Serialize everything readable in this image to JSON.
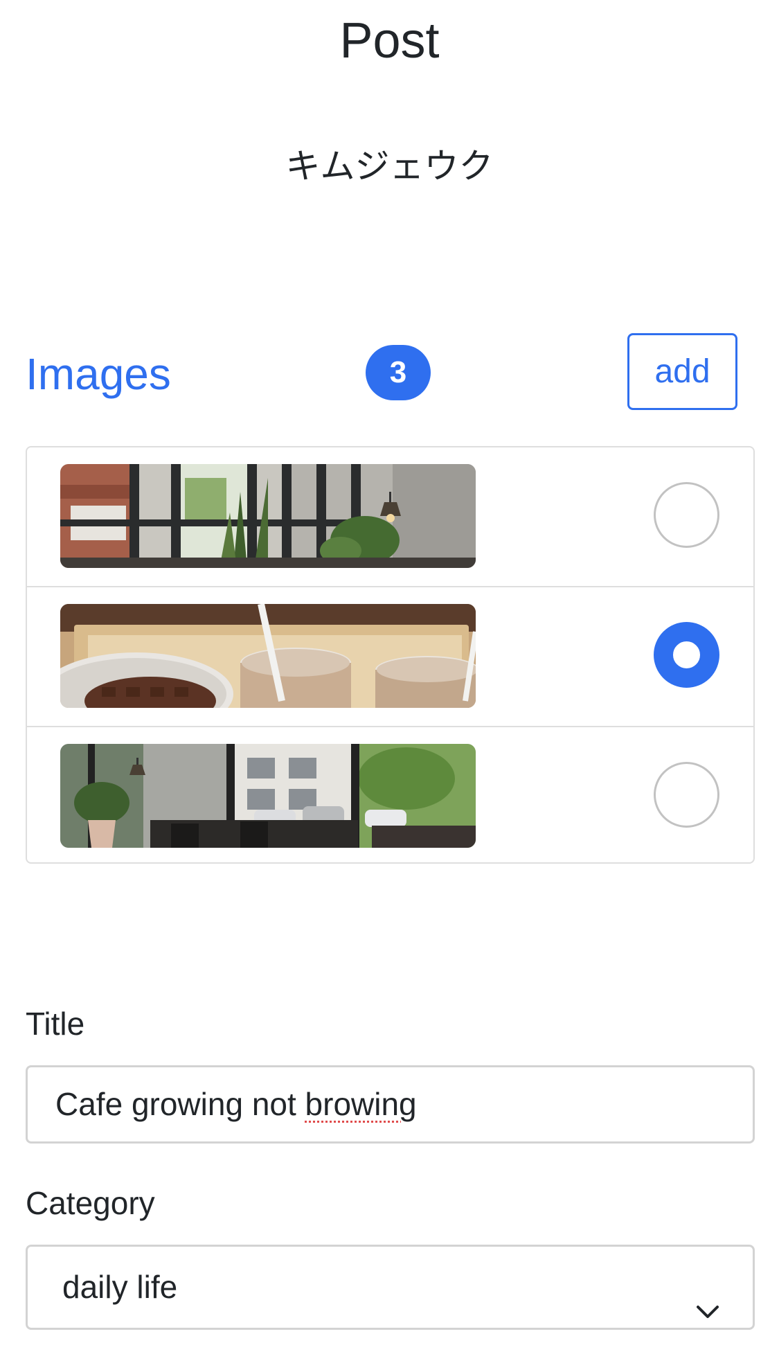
{
  "header": {
    "title": "Post",
    "author": "キムジェウク"
  },
  "images_section": {
    "heading": "Images",
    "count": "3",
    "add_label": "add",
    "items": [
      {
        "name": "cafe-window-interior-photo",
        "selected": false
      },
      {
        "name": "waffle-and-iced-coffee-photo",
        "selected": true
      },
      {
        "name": "cafe-street-view-photo",
        "selected": false
      }
    ]
  },
  "form": {
    "title_label": "Title",
    "title_value_part1": "Cafe growing not ",
    "title_value_part2": "browing",
    "category_label": "Category",
    "category_value": "daily life"
  },
  "icons": {
    "select_arrow": "chevron-down-icon"
  },
  "colors": {
    "accent": "#2f6fef",
    "border": "#d3d3d3"
  }
}
